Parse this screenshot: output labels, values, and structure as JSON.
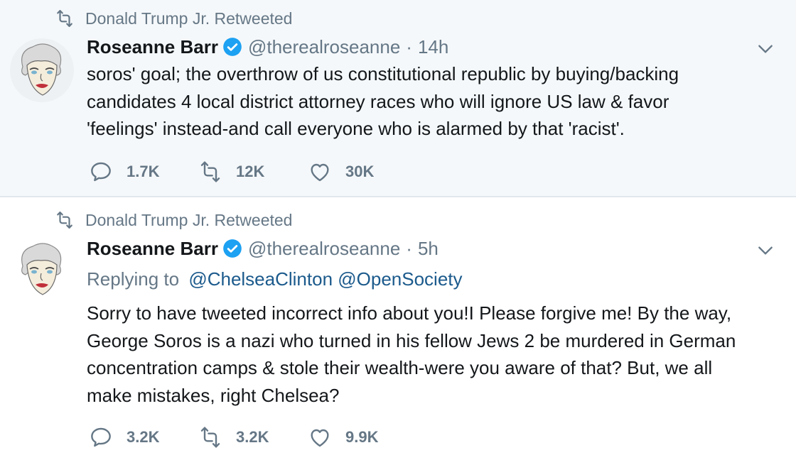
{
  "tweets": [
    {
      "retweeted_by": "Donald Trump Jr. Retweeted",
      "name": "Roseanne Barr",
      "handle": "@therealroseanne",
      "separator": "·",
      "time": "14h",
      "lines": [
        "soros' goal; the overthrow of us constitutional republic by buying/backing",
        "candidates 4 local district attorney races who will ignore US law & favor",
        "'feelings' instead-and call everyone who is alarmed by that 'racist'."
      ],
      "stats": {
        "replies": "1.7K",
        "retweets": "12K",
        "likes": "30K"
      }
    },
    {
      "retweeted_by": "Donald Trump Jr. Retweeted",
      "name": "Roseanne Barr",
      "handle": "@therealroseanne",
      "separator": "·",
      "time": "5h",
      "replying_to_label": "Replying to",
      "replying_to": "@ChelseaClinton @OpenSociety",
      "lines": [
        "Sorry to have tweeted incorrect info about you!I Please forgive me! By the way,",
        "George Soros is a nazi who turned in his fellow Jews 2 be murdered in German",
        "concentration camps & stole their wealth-were you aware of that?  But, we all",
        "make mistakes, right Chelsea?"
      ],
      "stats": {
        "replies": "3.2K",
        "retweets": "3.2K",
        "likes": "9.9K"
      }
    }
  ],
  "icons": {
    "retweet": "retweet-icon",
    "verified": "verified-badge-icon",
    "chevron": "chevron-down-icon",
    "reply": "reply-icon",
    "like": "heart-icon"
  },
  "colors": {
    "text": "#14171a",
    "secondary": "#657786",
    "verified": "#1da1f2",
    "mention": "#1b5a8c",
    "highlight_bg": "#f5f8fa",
    "divider": "#e1e8ed"
  }
}
